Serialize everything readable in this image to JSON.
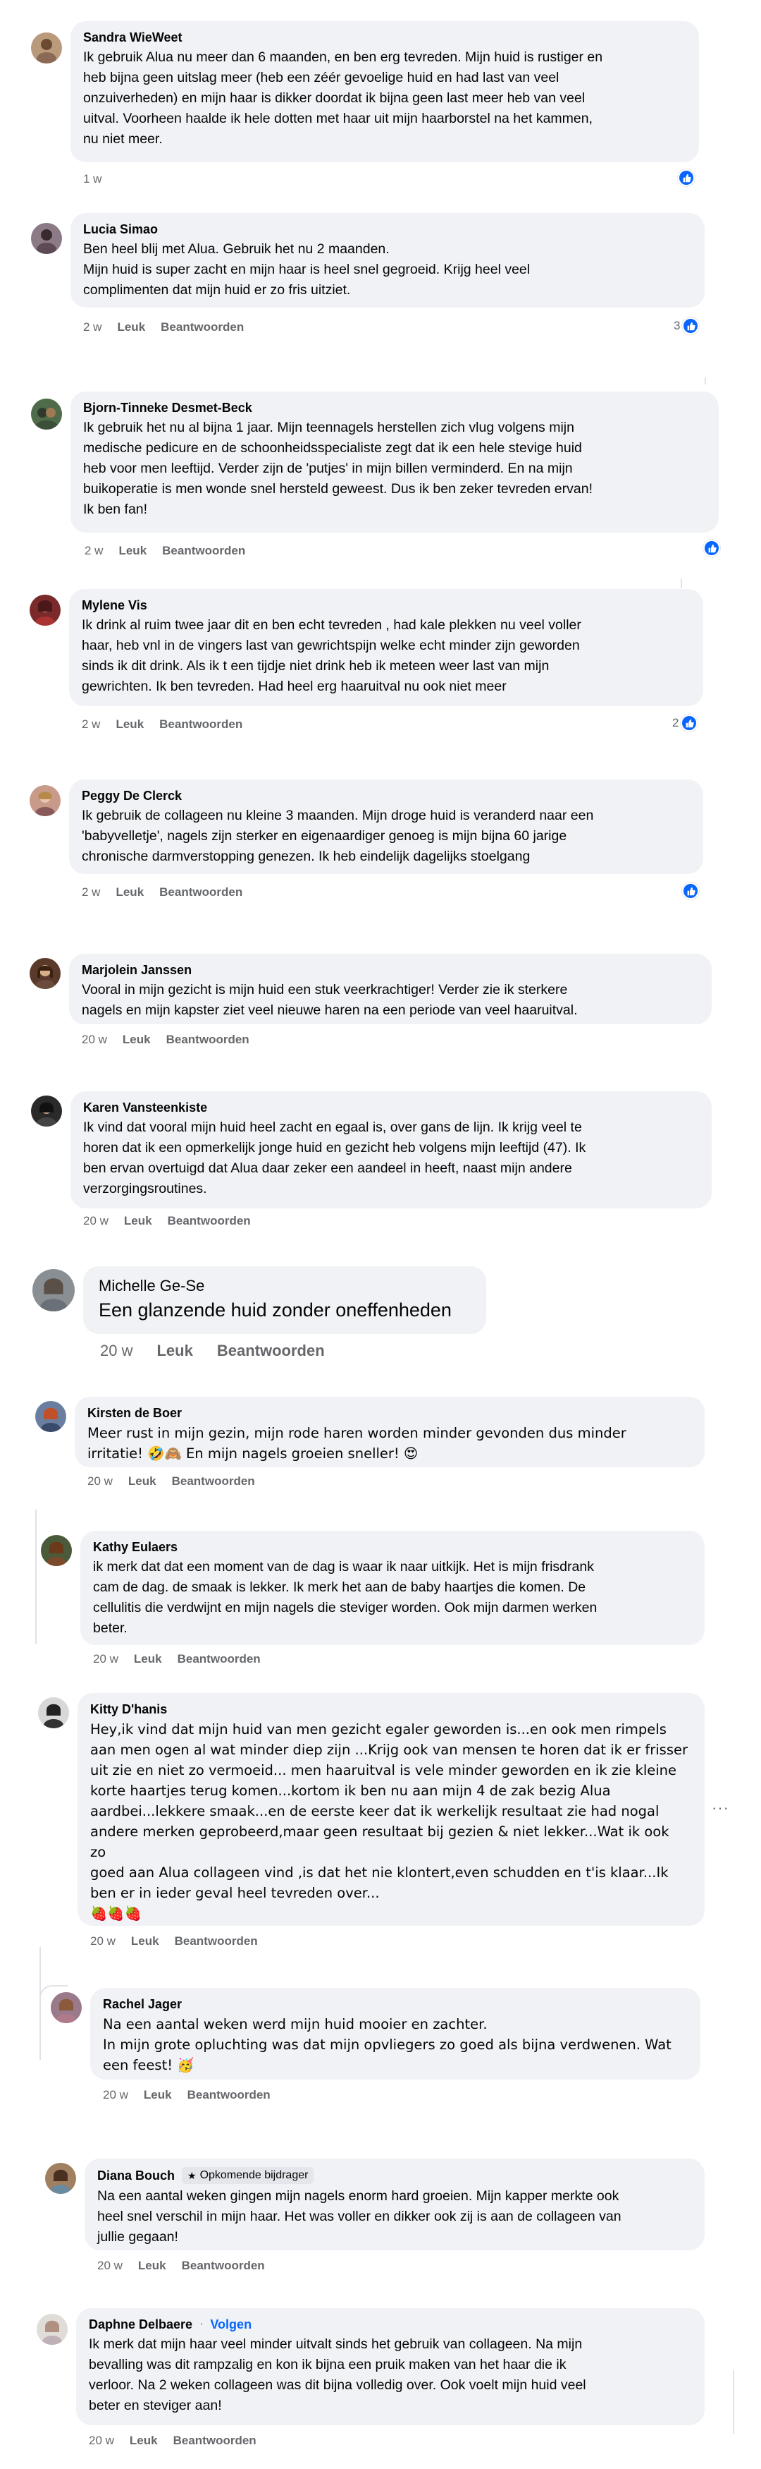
{
  "comments": [
    {
      "name": "Sandra WieWeet",
      "text": "Ik gebruik Alua nu meer dan 6 maanden, en ben erg tevreden. Mijn huid is rustiger en\nheb bijna geen uitslag meer (heb een zéér gevoelige huid en had last van veel\nonzuiverheden) en mijn haar is dikker doordat ik bijna geen last meer heb van veel\nuitval. Voorheen haalde ik hele dotten met haar uit mijn haarborstel na het kammen,\nnu niet meer.",
      "time": "1 w",
      "like": "Leuk",
      "reply": "Beantwoorden",
      "reaction_count": ""
    },
    {
      "name": "Lucia Simao",
      "text": "Ben heel blij met Alua. Gebruik het nu 2 maanden.\nMijn huid is super zacht en mijn haar is heel snel gegroeid. Krijg heel veel\ncomplimenten dat mijn huid er zo fris uitziet.",
      "time": "2 w",
      "like": "Leuk",
      "reply": "Beantwoorden",
      "reaction_count": "3"
    },
    {
      "name": "Bjorn-Tinneke Desmet-Beck",
      "text": "Ik gebruik het nu al bijna 1 jaar. Mijn teennagels herstellen zich vlug volgens mijn\nmedische pedicure en de schoonheidsspecialiste zegt dat ik een hele stevige huid\nheb voor men leeftijd. Verder zijn de 'putjes' in mijn billen verminderd. En na mijn\nbuikoperatie is men wonde snel hersteld geweest. Dus ik ben zeker tevreden ervan!\nIk ben fan!",
      "time": "2 w",
      "like": "Leuk",
      "reply": "Beantwoorden",
      "reaction_count": ""
    },
    {
      "name": "Mylene Vis",
      "text": "Ik drink al ruim twee jaar dit en ben echt tevreden , had kale plekken nu veel voller\nhaar, heb vnl in de vingers last van gewrichtspijn welke echt minder zijn geworden\nsinds ik dit drink. Als ik t een tijdje niet drink heb ik meteen weer last van mijn\ngewrichten. Ik ben tevreden. Had heel erg haaruitval nu ook niet meer",
      "time": "2 w",
      "like": "Leuk",
      "reply": "Beantwoorden",
      "reaction_count": "2"
    },
    {
      "name": "Peggy De Clerck",
      "text": "Ik gebruik de collageen nu kleine 3 maanden. Mijn droge huid is veranderd naar een\n'babyvelletje', nagels zijn sterker en eigenaardiger genoeg is mijn bijna 60 jarige\nchronische darmverstopping genezen. Ik heb eindelijk dagelijks stoelgang",
      "time": "2 w",
      "like": "Leuk",
      "reply": "Beantwoorden",
      "reaction_count": ""
    },
    {
      "name": "Marjolein Janssen",
      "text": "Vooral in mijn gezicht is mijn huid een stuk veerkrachtiger! Verder zie ik sterkere\nnagels en mijn kapster ziet veel nieuwe haren na een periode van veel haaruitval.",
      "time": "20 w",
      "like": "Leuk",
      "reply": "Beantwoorden"
    },
    {
      "name": "Karen Vansteenkiste",
      "text": "Ik vind dat vooral mijn huid heel zacht en egaal is, over gans de lijn. Ik krijg veel te\nhoren dat ik een opmerkelijk jonge huid en gezicht heb volgens mijn leeftijd (47). Ik\nben ervan overtuigd dat Alua daar zeker een aandeel in heeft, naast mijn andere\nverzorgingsroutines.",
      "time": "20 w",
      "like": "Leuk",
      "reply": "Beantwoorden"
    },
    {
      "name": "Michelle Ge-Se",
      "text": "Een glanzende huid zonder oneffenheden",
      "time": "20 w",
      "like": "Leuk",
      "reply": "Beantwoorden"
    },
    {
      "name": "Kirsten de Boer",
      "text": "Meer rust in mijn gezin, mijn rode haren worden minder gevonden dus minder\nirritatie! 🤣🙈 En mijn nagels groeien sneller! 😍",
      "time": "20 w",
      "like": "Leuk",
      "reply": "Beantwoorden"
    },
    {
      "name": "Kathy Eulaers",
      "text": "ik merk dat dat een moment van de dag is waar ik naar uitkijk. Het is mijn frisdrank\ncam de dag. de smaak is lekker. Ik merk het aan de baby haartjes die komen. De\ncellulitis die verdwijnt en mijn nagels die steviger worden. Ook mijn darmen werken\nbeter.",
      "time": "20 w",
      "like": "Leuk",
      "reply": "Beantwoorden"
    },
    {
      "name": "Kitty D'hanis",
      "text": "Hey,ik vind dat mijn huid van men gezicht egaler geworden is...en ook men rimpels\naan men ogen al wat minder diep zijn ...Krijg ook van mensen te horen dat ik er frisser\nuit zie en niet zo vermoeid... men haaruitval is vele minder geworden en ik zie kleine\nkorte haartjes terug komen...kortom ik ben nu aan mijn 4 de zak bezig Alua\naardbei...lekkere smaak...en de eerste keer dat ik werkelijk resultaat zie had nogal\nandere merken geprobeerd,maar geen resultaat bij gezien & niet lekker...Wat ik ook\nzo\ngoed aan Alua collageen vind ,is dat het nie klontert,even schudden en t'is klaar...Ik\nben er in ieder geval heel tevreden over...\n🍓🍓🍓",
      "time": "20 w",
      "like": "Leuk",
      "reply": "Beantwoorden",
      "more": "···"
    },
    {
      "name": "Rachel Jager",
      "text": "Na een aantal weken werd mijn huid mooier en zachter.\nIn mijn grote opluchting was dat mijn opvliegers zo goed als bijna verdwenen. Wat\neen feest! 🥳",
      "time": "20 w",
      "like": "Leuk",
      "reply": "Beantwoorden"
    },
    {
      "name": "Diana Bouch",
      "badge": "Opkomende bijdrager",
      "text": "Na een aantal weken gingen mijn nagels enorm hard groeien. Mijn kapper merkte ook\nheel snel verschil in mijn haar. Het was voller en dikker ook zij is aan de collageen van\njullie gegaan!",
      "time": "20 w",
      "like": "Leuk",
      "reply": "Beantwoorden"
    },
    {
      "name": "Daphne Delbaere",
      "follow": "Volgen",
      "text": "Ik merk dat mijn haar veel minder uitvalt sinds het gebruik van collageen. Na mijn\nbevalling was dit rampzalig en kon ik bijna een pruik maken van het haar die ik\nverloor. Na 2 weken collageen was dit bijna volledig over. Ook voelt mijn huid veel\nbeter en steviger aan!",
      "time": "20 w",
      "like": "Leuk",
      "reply": "Beantwoorden"
    }
  ],
  "colors": {
    "bubble": "#f0f2f5",
    "like_blue": "#0866ff",
    "meta_gray": "#65676b",
    "thread_line": "#dfe2e6"
  }
}
